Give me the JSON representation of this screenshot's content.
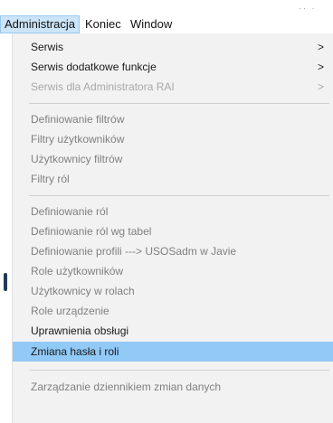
{
  "menubar": {
    "items": [
      {
        "label": "Administracja",
        "active": true
      },
      {
        "label": "Koniec",
        "active": false
      },
      {
        "label": "Window",
        "active": false
      }
    ]
  },
  "menu": {
    "items": [
      {
        "label": "Serwis",
        "state": "enabled",
        "submenu": true
      },
      {
        "label": "Serwis dodatkowe funkcje",
        "state": "enabled",
        "submenu": true
      },
      {
        "label": "Serwis dla Administratora RAI",
        "state": "disabled",
        "submenu": true
      },
      {
        "label": "Definiowanie filtrów",
        "state": "dim",
        "submenu": false
      },
      {
        "label": "Filtry użytkowników",
        "state": "dim",
        "submenu": false
      },
      {
        "label": "Użytkownicy filtrów",
        "state": "dim",
        "submenu": false
      },
      {
        "label": "Filtry ról",
        "state": "dim",
        "submenu": false
      },
      {
        "label": "Definiowanie ról",
        "state": "dim",
        "submenu": false
      },
      {
        "label": "Definiowanie ról wg tabel",
        "state": "dim",
        "submenu": false
      },
      {
        "label": "Definiowanie profili ---> USOSadm w Javie",
        "state": "dim",
        "submenu": false
      },
      {
        "label": "Role użytkowników",
        "state": "dim",
        "submenu": false
      },
      {
        "label": "Użytkownicy w rolach",
        "state": "dim",
        "submenu": false
      },
      {
        "label": "Role urządzenie",
        "state": "dim",
        "submenu": false
      },
      {
        "label": "Uprawnienia obsługi",
        "state": "enabled",
        "submenu": false
      },
      {
        "label": "Zmiana hasła i roli",
        "state": "highlighted",
        "submenu": false
      },
      {
        "label": "Zarządzanie dziennikiem zmian danych",
        "state": "dim",
        "submenu": false
      }
    ],
    "submenu_arrow": ">"
  },
  "colors": {
    "menu_background": "#f2f2f2",
    "highlight": "#91c9f7",
    "menubar_active": "#cce4f7",
    "enabled_text": "#1a1a1a",
    "dim_text": "#808080",
    "disabled_text": "#a8a8a8"
  },
  "icons": {
    "submenu": "chevron-right-icon"
  }
}
